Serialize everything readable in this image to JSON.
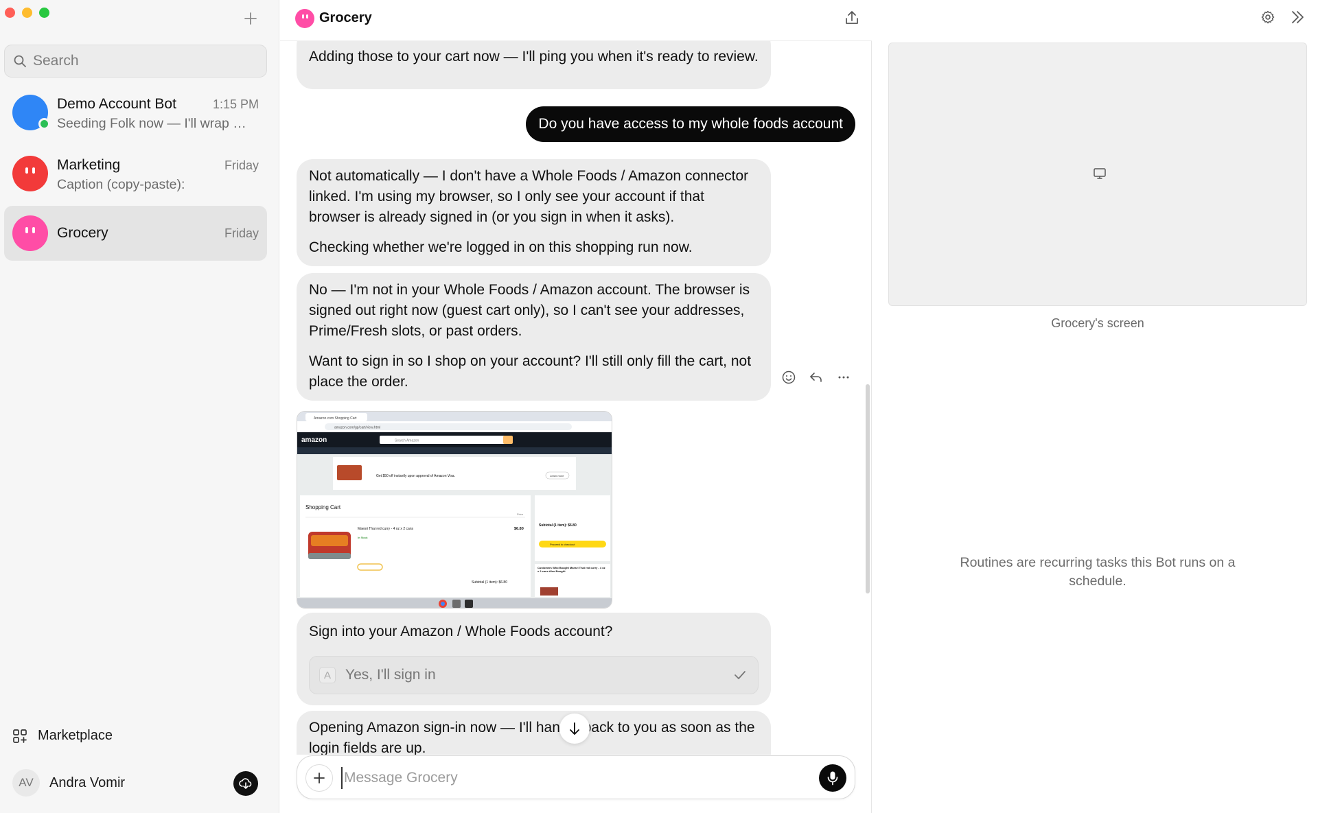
{
  "sidebar": {
    "search_placeholder": "Search",
    "chats": [
      {
        "name": "Demo Account Bot",
        "time": "1:15 PM",
        "preview": "Seeding Folk now — I'll wrap …",
        "avatar_color": "#2f86f6",
        "online": true
      },
      {
        "name": "Marketing",
        "time": "Friday",
        "preview": "Caption (copy-paste):",
        "avatar_color": "#f23a3a",
        "online": false
      },
      {
        "name": "Grocery",
        "time": "Friday",
        "preview": "",
        "avatar_color": "#ff4da6",
        "online": false,
        "active": true
      }
    ],
    "marketplace_label": "Marketplace",
    "user": {
      "initials": "AV",
      "name": "Andra Vomir"
    }
  },
  "chat": {
    "title": "Grocery",
    "messages": {
      "m1": "Adding those to your cart now — I'll ping you when it's ready to review.",
      "user1": "Do you have access to my whole foods account",
      "m2_p1": "Not automatically — I don't have a Whole Foods / Amazon connector linked. I'm using my browser, so I only see your account if that browser is already signed in (or you sign in when it asks).",
      "m2_p2": "Checking whether we're logged in on this shopping run now.",
      "m3_p1": "No — I'm not in your Whole Foods / Amazon account. The browser is signed out right now (guest cart only), so I can't see your addresses, Prime/Fresh slots, or past orders.",
      "m3_p2": "Want to sign in so I shop on your account? I'll still only fill the cart, not place the order.",
      "m4": "Opening Amazon sign-in now — I'll hand it back to you as soon as the login fields are up."
    },
    "screenshot": {
      "tab_title": "Amazon.com Shopping Cart",
      "url": "amazon.com/gp/cart/view.html",
      "logo": "amazon",
      "search_placeholder": "Search Amazon",
      "promo": "Get $50 off instantly upon approval of Amazon Visa.",
      "promo_button": "Learn more",
      "cart_heading": "Shopping Cart",
      "price_column": "Price",
      "item_name": "Maesri Thai red curry - 4 oz x 2 cans",
      "item_price": "$6.80",
      "item_stock": "In Stock",
      "subtotal": "Subtotal (1 item): $6.80",
      "checkout_button": "Proceed to checkout",
      "also_bought": "Customers Who Bought Maesri Thai red curry - 4 oz x 2 cans Also Bought"
    },
    "question": {
      "title": "Sign into your Amazon / Whole Foods account?",
      "option_key": "A",
      "option_label": "Yes, I'll sign in"
    },
    "composer_placeholder": "Message Grocery"
  },
  "right_panel": {
    "screen_caption": "Grocery's screen",
    "routines_text": "Routines are recurring tasks this Bot runs on a schedule."
  }
}
